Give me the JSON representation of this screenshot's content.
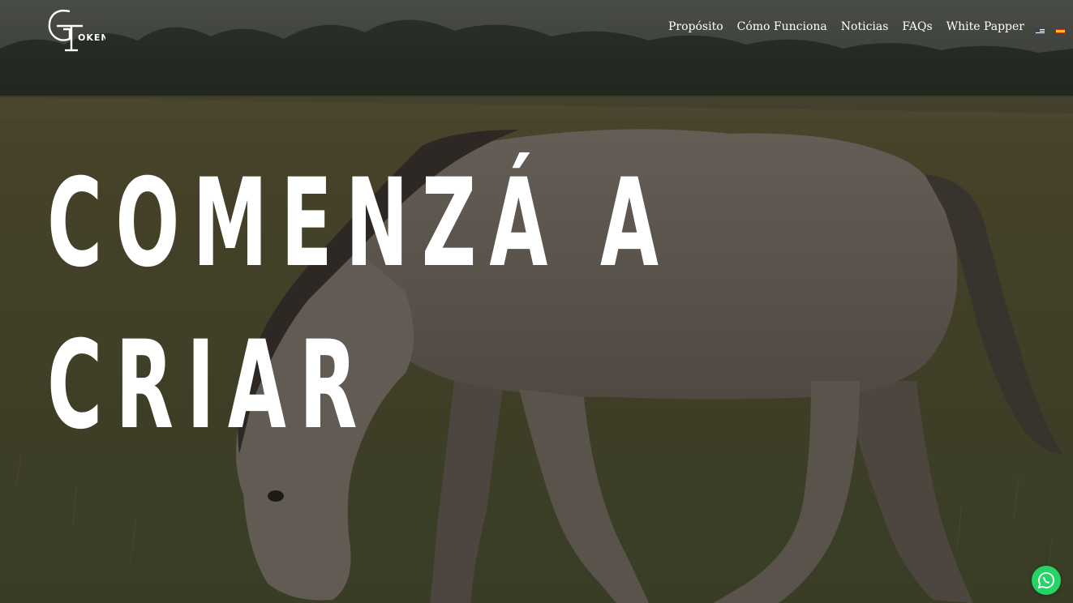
{
  "brand": {
    "logo_text": "GT OKEN",
    "logo_icon": "gt-monogram-logo"
  },
  "nav": {
    "items": [
      {
        "label": "Propósito"
      },
      {
        "label": "Cómo Funciona"
      },
      {
        "label": "Noticias"
      },
      {
        "label": "FAQs"
      },
      {
        "label": "White Papper"
      }
    ],
    "languages": [
      {
        "icon": "us-flag-icon"
      },
      {
        "icon": "es-flag-icon"
      }
    ]
  },
  "hero": {
    "headline_line1": "COMENZÁ A",
    "headline_line2": "CRIAR",
    "background_icon": "grazing-horse-photo"
  },
  "floating": {
    "whatsapp_icon": "whatsapp-icon",
    "whatsapp_color": "#25d366"
  }
}
